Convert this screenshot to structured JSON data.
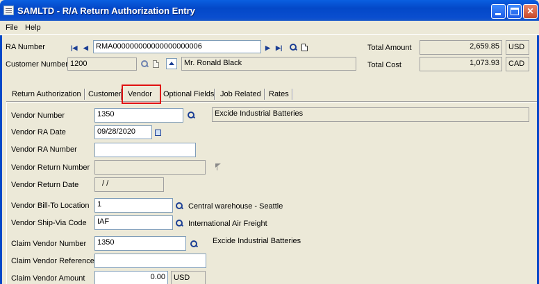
{
  "window": {
    "title": "SAMLTD - R/A Return Authorization Entry"
  },
  "menu": [
    "File",
    "Help"
  ],
  "header": {
    "ra_number_label": "RA Number",
    "ra_number_value": "RMA000000000000000000006",
    "customer_number_label": "Customer Number",
    "customer_number_value": "1200",
    "customer_name": "Mr. Ronald Black",
    "total_amount_label": "Total Amount",
    "total_amount_value": "2,659.85",
    "total_amount_currency": "USD",
    "total_cost_label": "Total Cost",
    "total_cost_value": "1,073.93",
    "total_cost_currency": "CAD"
  },
  "tabs": [
    {
      "label": "Return Authorization",
      "active": false
    },
    {
      "label": "Customer",
      "active": false
    },
    {
      "label": "Vendor",
      "active": true
    },
    {
      "label": "Optional Fields",
      "active": false
    },
    {
      "label": "Job Related",
      "active": false
    },
    {
      "label": "Rates",
      "active": false
    }
  ],
  "vendor": {
    "vendor_number_label": "Vendor Number",
    "vendor_number_value": "1350",
    "vendor_name": "Excide Industrial Batteries",
    "vendor_ra_date_label": "Vendor RA Date",
    "vendor_ra_date_value": "09/28/2020",
    "vendor_ra_number_label": "Vendor RA Number",
    "vendor_ra_number_value": "",
    "vendor_return_number_label": "Vendor Return Number",
    "vendor_return_number_value": "",
    "vendor_return_date_label": "Vendor Return Date",
    "vendor_return_date_value": "/ /",
    "bill_to_label": "Vendor Bill-To Location",
    "bill_to_value": "1",
    "bill_to_desc": "Central warehouse - Seattle",
    "ship_via_label": "Vendor Ship-Via Code",
    "ship_via_value": "IAF",
    "ship_via_desc": "International Air Freight",
    "claim_vendor_number_label": "Claim Vendor Number",
    "claim_vendor_number_value": "1350",
    "claim_vendor_name": "Excide Industrial Batteries",
    "claim_vendor_reference_label": "Claim Vendor Reference",
    "claim_vendor_reference_value": "",
    "claim_vendor_amount_label": "Claim Vendor Amount",
    "claim_vendor_amount_value": "0.00",
    "claim_vendor_amount_currency": "USD"
  },
  "colors": {
    "titlebar": "#0A5FE0",
    "window_bg": "#ECE9D8",
    "active_tab_highlight": "#E01010"
  }
}
